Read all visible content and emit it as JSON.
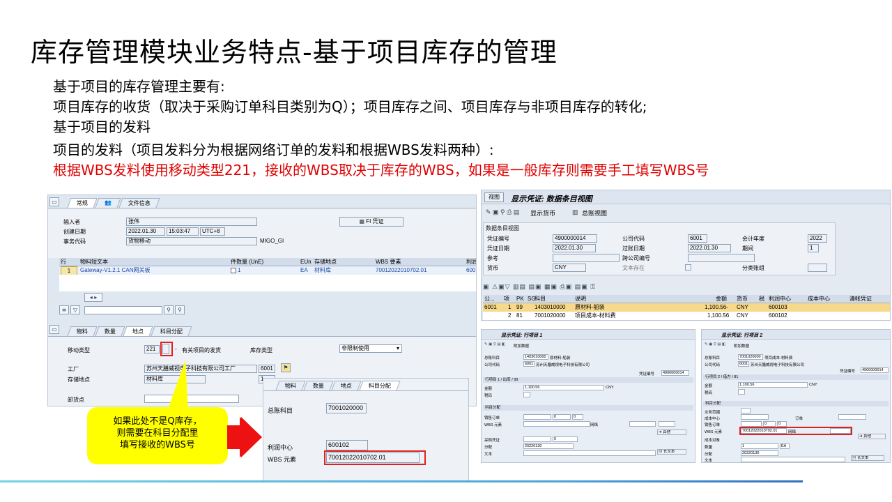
{
  "slide": {
    "title": "库存管理模块业务特点-基于项目库存的管理",
    "lines": [
      "基于项目的库存管理主要有:",
      "项目库存的收货（取决于采购订单科目类别为Q）；项目库存之间、项目库存与非项目库存的转化;",
      "基于项目的发料",
      "项目的发料（项目发料分为根据网络订单的发料和根据WBS发料两种）:"
    ],
    "red_line": "根据WBS发料使用移动类型221，接收的WBS取决于库存的WBS，如果是一般库存则需要手工填写WBS号"
  },
  "callout": {
    "text": "如果此处不是Q库存，则需要在科目分配里填写接收的WBS号",
    "color": "#ffff00"
  },
  "left_panel": {
    "tabs": [
      "常规",
      "文件信息"
    ],
    "entered_by_label": "输入者",
    "entered_by": "张伟",
    "created_label": "创建日期",
    "created_date": "2022.01.30",
    "created_time": "15:03:47",
    "tz": "UTC+8",
    "event_label": "事务代码",
    "event_value": "货物移动",
    "event_code": "MIGO_GI",
    "fi_button": "FI 凭证",
    "grid_headers": [
      "行",
      "物料短文本",
      "件",
      "数量 (UnE)",
      "EUn",
      "存储地点",
      "WBS 要素",
      "利润中"
    ],
    "grid_row": {
      "line": "1",
      "text": "Gateway-V1.2.1 CAN网关板",
      "qty": "1",
      "unit": "EA",
      "sloc": "材料库",
      "wbs": "70012022010702.01",
      "profit": "6001"
    },
    "detail_tabs": [
      "物料",
      "数量",
      "地点",
      "科目分配"
    ],
    "movement_type_label": "移动类型",
    "movement_type": "221",
    "movement_sep": "-",
    "movement_text": "有关项目的发货",
    "stock_type_label": "库存类型",
    "stock_type": "非限制使用",
    "plant_label": "工厂",
    "plant_name": "苏州天膳威视电子科技有限公司工厂",
    "plant_code": "6001",
    "sloc_label": "存储地点",
    "sloc_value": "材料库",
    "sloc_code": "1",
    "unload_label": "卸货点"
  },
  "acct_panel": {
    "tabs": [
      "物料",
      "数量",
      "地点",
      "科目分配"
    ],
    "gl_label": "总账科目",
    "gl_value": "7001020000",
    "profit_label": "利润中心",
    "profit_value": "600102",
    "wbs_label": "WBS 元素",
    "wbs_value": "70012022010702.01"
  },
  "right_top": {
    "window_btn": "视图",
    "title": "显示凭证: 数据条目视图",
    "toolbar_text1": "显示货币",
    "toolbar_text2": "总账视图",
    "section": "数据条目视图",
    "doc_no_label": "凭证编号",
    "doc_no": "4900000014",
    "company_label": "公司代码",
    "company": "6001",
    "fiscal_label": "会计年度",
    "fiscal": "2022",
    "doc_date_label": "凭证日期",
    "doc_date": "2022.01.30",
    "post_date_label": "过账日期",
    "post_date": "2022.01.30",
    "period_label": "期间",
    "period": "1",
    "ref_label": "参考",
    "cross_label": "跨公司编号",
    "currency_label": "货币",
    "currency": "CNY",
    "text_exists_label": "文本存在",
    "ledger_label": "分类账组",
    "grid_headers": [
      "公...",
      "项",
      "PK",
      "SG",
      "科目",
      "说明",
      "金额",
      "货币",
      "税",
      "利润中心",
      "成本中心",
      "清帐凭证"
    ],
    "rows": [
      {
        "co": "6001",
        "item": "1",
        "pk": "99",
        "acct": "1403010000",
        "desc": "原材料-船装",
        "amount": "1,100.56-",
        "cur": "CNY",
        "pc": "600103"
      },
      {
        "co": "",
        "item": "2",
        "pk": "81",
        "acct": "7001020000",
        "desc": "项目成本-材料费",
        "amount": "1,100.56",
        "cur": "CNY",
        "pc": "600102"
      }
    ]
  },
  "mini1": {
    "title": "显示凭证: 行项目 1",
    "toolbar": "附加数据",
    "gl_label": "总账科目",
    "gl_value": "1403010000",
    "gl_desc": "原材料-船装",
    "co_label": "公司代码",
    "co_value": "6001",
    "co_name": "苏州天膳威视电子科技有限公司",
    "doc_label": "凭证编号",
    "doc_value": "4900000014",
    "section1": "行项目 1 / 出库 / 99",
    "amount_label": "金额",
    "amount": "1,100.56",
    "cur": "CNY",
    "tax_label": "税码",
    "section2": "科目分配",
    "so_label": "销售订单",
    "so_a": "0",
    "so_b": "0",
    "wbs_label": "WBS 元素",
    "net_label": "网络",
    "more_btn": "其他",
    "po_label": "采购凭证",
    "po_val": "0",
    "assign_label": "分配",
    "assign_val": "20220130",
    "text_label": "文本",
    "long_btn": "长文本"
  },
  "mini2": {
    "title": "显示凭证: 行项目 2",
    "toolbar": "附加数据",
    "gl_label": "总账科目",
    "gl_value": "7001020000",
    "gl_desc": "项目成本-材料费",
    "co_label": "公司代码",
    "co_value": "6001",
    "co_name": "苏州天膳威视电子科技有限公司",
    "doc_label": "凭证编号",
    "doc_value": "4900000014",
    "section1": "行项目 2 / 借方 / 81",
    "amount_label": "金额",
    "amount": "1,100.56",
    "cur": "CNY",
    "tax_label": "税码",
    "section2": "科目分配",
    "bu_label": "业务范围",
    "cc_label": "成本中心",
    "order_label": "订单",
    "so_label": "销售订单",
    "so_a": "0",
    "so_b": "0",
    "wbs_label": "WBS 元素",
    "wbs_value": "70012022010702.01",
    "net_label": "网络",
    "more_btn": "其他",
    "cost_obj_label": "成本对象",
    "qty_label": "数量",
    "qty_val": "1",
    "qty_unit": "EA",
    "assign_label": "分配",
    "assign_val": "20220130",
    "text_label": "文本",
    "long_btn": "长文本"
  }
}
